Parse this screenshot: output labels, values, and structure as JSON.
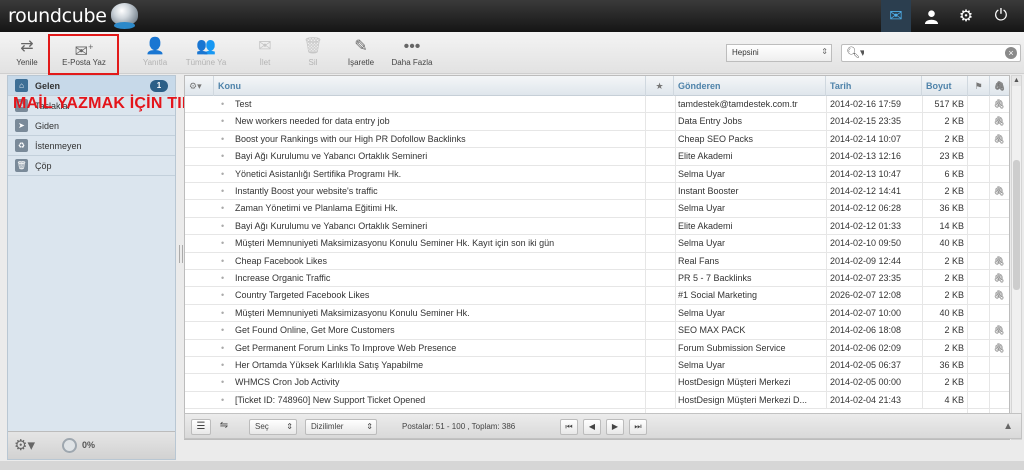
{
  "app": {
    "logo_text": "roundcube"
  },
  "topnav": {
    "mail_icon": "envelope-icon",
    "user_icon": "user-icon",
    "settings_icon": "gear-icon",
    "logout_icon": "power-icon"
  },
  "toolbar": {
    "refresh": "Yenile",
    "compose": "E-Posta Yaz",
    "reply": "Yanıtla",
    "reply_all": "Tümüne Ya",
    "forward": "İlet",
    "delete": "Sil",
    "mark": "İşaretle",
    "more": "Daha Fazla",
    "filter_value": "Hepsini",
    "search_placeholder": ""
  },
  "overlay": {
    "text": "MAİL YAZMAK İÇİN TIKLAYINIZ"
  },
  "folders": [
    {
      "label": "Gelen",
      "badge": "1"
    },
    {
      "label": "Taslaklar",
      "badge": ""
    },
    {
      "label": "Giden",
      "badge": ""
    },
    {
      "label": "İstenmeyen",
      "badge": ""
    },
    {
      "label": "Çöp",
      "badge": ""
    }
  ],
  "quota": {
    "text": "0%"
  },
  "columns": {
    "subject": "Konu",
    "from": "Gönderen",
    "date": "Tarih",
    "size": "Boyut"
  },
  "messages": [
    {
      "subject": "Test",
      "from": "tamdestek@tamdestek.com.tr",
      "date": "2014-02-16 17:59",
      "size": "517 KB",
      "attach": true
    },
    {
      "subject": "New workers needed for data entry job",
      "from": "Data Entry Jobs",
      "date": "2014-02-15 23:35",
      "size": "2 KB",
      "attach": true
    },
    {
      "subject": "Boost your Rankings with our High PR Dofollow Backlinks",
      "from": "Cheap SEO Packs",
      "date": "2014-02-14 10:07",
      "size": "2 KB",
      "attach": true
    },
    {
      "subject": "Bayi Ağı Kurulumu ve Yabancı Ortaklık Semineri",
      "from": "Elite Akademi",
      "date": "2014-02-13 12:16",
      "size": "23 KB",
      "attach": false
    },
    {
      "subject": "Yönetici Asistanlığı Sertifika Programı Hk.",
      "from": "Selma Uyar",
      "date": "2014-02-13 10:47",
      "size": "6 KB",
      "attach": false
    },
    {
      "subject": "Instantly Boost your website's traffic",
      "from": "Instant Booster",
      "date": "2014-02-12 14:41",
      "size": "2 KB",
      "attach": true
    },
    {
      "subject": "Zaman Yönetimi ve Planlama Eğitimi Hk.",
      "from": "Selma Uyar",
      "date": "2014-02-12 06:28",
      "size": "36 KB",
      "attach": false
    },
    {
      "subject": "Bayi Ağı Kurulumu ve Yabancı Ortaklık Semineri",
      "from": "Elite Akademi",
      "date": "2014-02-12 01:33",
      "size": "14 KB",
      "attach": false
    },
    {
      "subject": "Müşteri Memnuniyeti Maksimizasyonu Konulu Seminer Hk. Kayıt için son iki gün",
      "from": "Selma Uyar",
      "date": "2014-02-10 09:50",
      "size": "40 KB",
      "attach": false
    },
    {
      "subject": "Cheap Facebook Likes",
      "from": "Real Fans",
      "date": "2014-02-09 12:44",
      "size": "2 KB",
      "attach": true
    },
    {
      "subject": "Increase Organic Traffic",
      "from": "PR 5 - 7 Backlinks",
      "date": "2014-02-07 23:35",
      "size": "2 KB",
      "attach": true
    },
    {
      "subject": "Country Targeted Facebook Likes",
      "from": "#1 Social Marketing",
      "date": "2026-02-07 12:08",
      "size": "2 KB",
      "attach": true
    },
    {
      "subject": "Müşteri Memnuniyeti Maksimizasyonu Konulu Seminer Hk.",
      "from": "Selma Uyar",
      "date": "2014-02-07 10:00",
      "size": "40 KB",
      "attach": false
    },
    {
      "subject": "Get Found Online, Get More Customers",
      "from": "SEO MAX PACK",
      "date": "2014-02-06 18:08",
      "size": "2 KB",
      "attach": true
    },
    {
      "subject": "Get Permanent Forum Links To Improve Web Presence",
      "from": "Forum Submission Service",
      "date": "2014-02-06 02:09",
      "size": "2 KB",
      "attach": true
    },
    {
      "subject": "Her Ortamda Yüksek Karlılıkla Satış Yapabilme",
      "from": "Selma Uyar",
      "date": "2014-02-05 06:37",
      "size": "36 KB",
      "attach": false
    },
    {
      "subject": "WHMCS Cron Job Activity",
      "from": "HostDesign Müşteri Merkezi",
      "date": "2014-02-05 00:00",
      "size": "2 KB",
      "attach": false
    },
    {
      "subject": "[Ticket ID: 748960] New Support Ticket Opened",
      "from": "HostDesign Müşteri Merkezi D...",
      "date": "2014-02-04 21:43",
      "size": "4 KB",
      "attach": false
    }
  ],
  "listfooter": {
    "select_label": "Seç",
    "threads_label": "Dizilimler",
    "count_text": "Postalar: 51 - 100 , Toplam: 386"
  }
}
